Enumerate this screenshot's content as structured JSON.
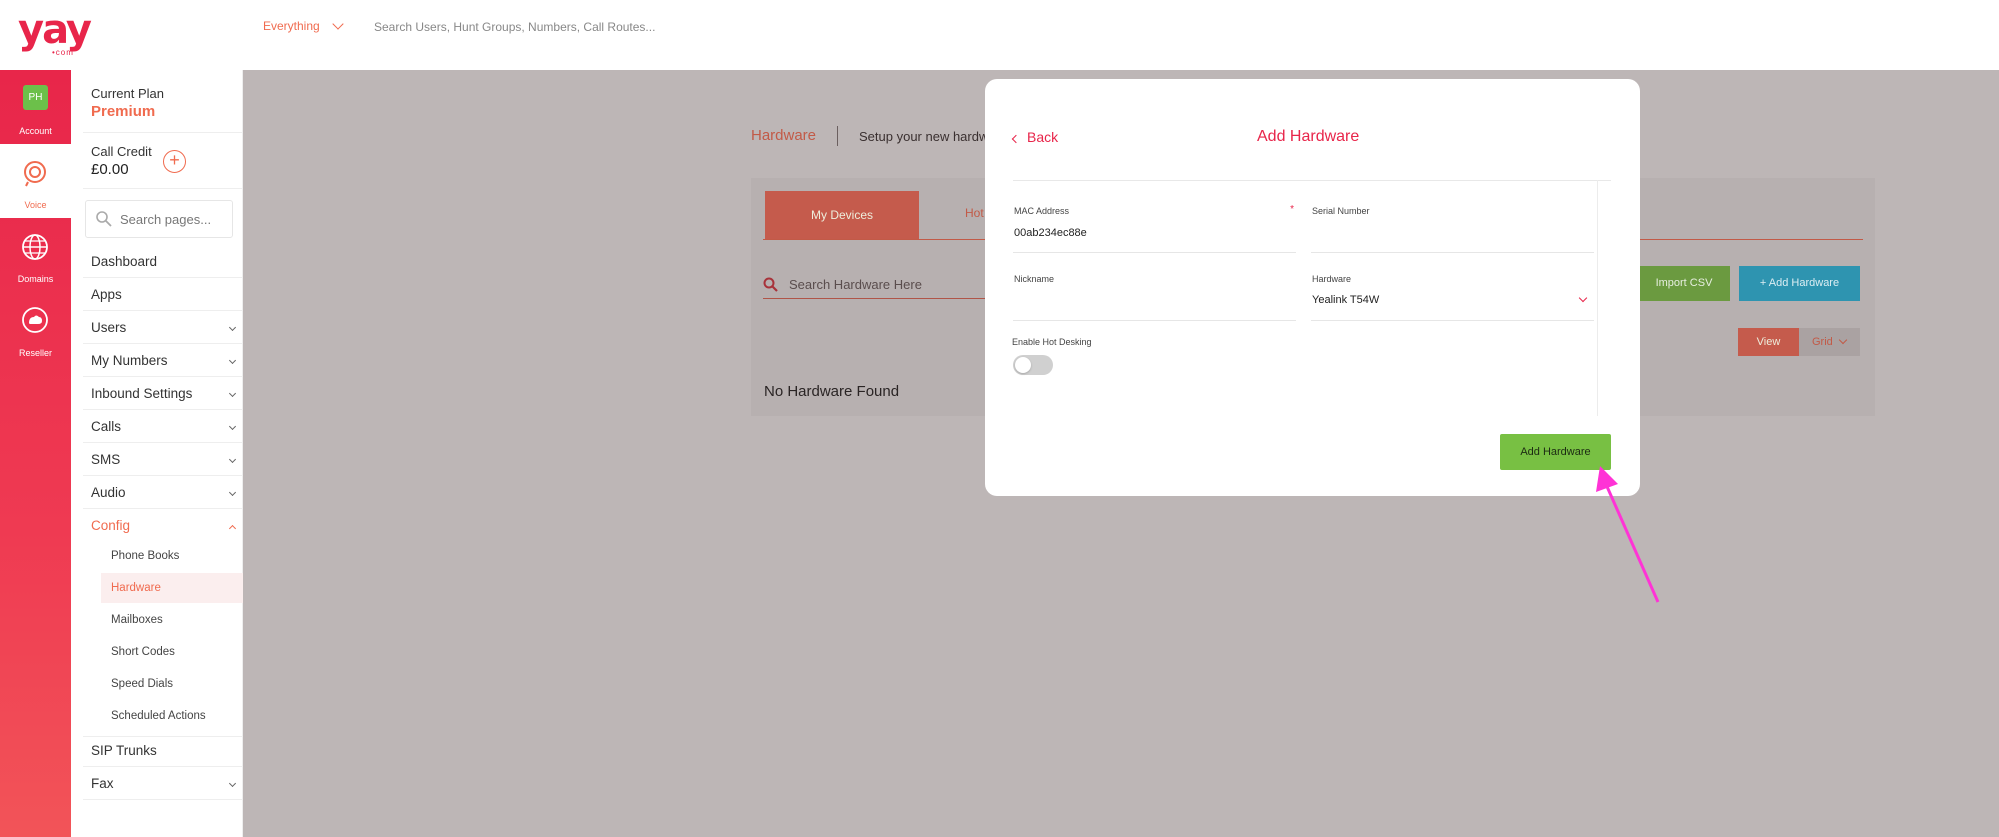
{
  "brand": {
    "logo_text": "yay",
    "logo_dots": "•com"
  },
  "topbar": {
    "scope_label": "Everything",
    "search_placeholder": "Search Users, Hunt Groups, Numbers, Call Routes..."
  },
  "rail": {
    "account": {
      "initials": "PH",
      "label": "Account"
    },
    "voice": {
      "label": "Voice"
    },
    "domains": {
      "label": "Domains"
    },
    "reseller": {
      "label": "Reseller"
    }
  },
  "sidemenu": {
    "plan_label": "Current Plan",
    "plan_tier": "Premium",
    "credit_label": "Call Credit",
    "credit_amount": "£0.00",
    "search_placeholder": "Search pages...",
    "items": [
      {
        "label": "Dashboard"
      },
      {
        "label": "Apps"
      },
      {
        "label": "Users"
      },
      {
        "label": "My Numbers"
      },
      {
        "label": "Inbound Settings"
      },
      {
        "label": "Calls"
      },
      {
        "label": "SMS"
      },
      {
        "label": "Audio"
      },
      {
        "label": "Config"
      }
    ],
    "config_sub": [
      {
        "label": "Phone Books"
      },
      {
        "label": "Hardware"
      },
      {
        "label": "Mailboxes"
      },
      {
        "label": "Short Codes"
      },
      {
        "label": "Speed Dials"
      },
      {
        "label": "Scheduled Actions"
      }
    ],
    "bottom_items": [
      {
        "label": "SIP Trunks"
      },
      {
        "label": "Fax"
      }
    ]
  },
  "background_page": {
    "title": "Hardware",
    "subtitle": "Setup your new hardw",
    "tab_active": "My Devices",
    "tab_other": "Hot",
    "search_placeholder": "Search Hardware Here",
    "import_csv": "Import CSV",
    "add_hardware": "+ Add Hardware",
    "view_label": "View",
    "grid_label": "Grid",
    "empty_text": "No Hardware Found"
  },
  "modal": {
    "back_label": "Back",
    "title": "Add Hardware",
    "mac_label": "MAC Address",
    "mac_value": "00ab234ec88e",
    "required_mark": "*",
    "serial_label": "Serial Number",
    "serial_value": "",
    "nickname_label": "Nickname",
    "nickname_value": "",
    "hardware_label": "Hardware",
    "hardware_value": "Yealink T54W",
    "hot_desking_label": "Enable Hot Desking",
    "hot_desking_enabled": false,
    "submit_label": "Add Hardware"
  },
  "colors": {
    "brand_red": "#e8254a",
    "accent_orange": "#f06b4f",
    "success_green": "#78c043",
    "info_blue": "#2e94b0",
    "annotation_arrow": "#ff33d6"
  }
}
